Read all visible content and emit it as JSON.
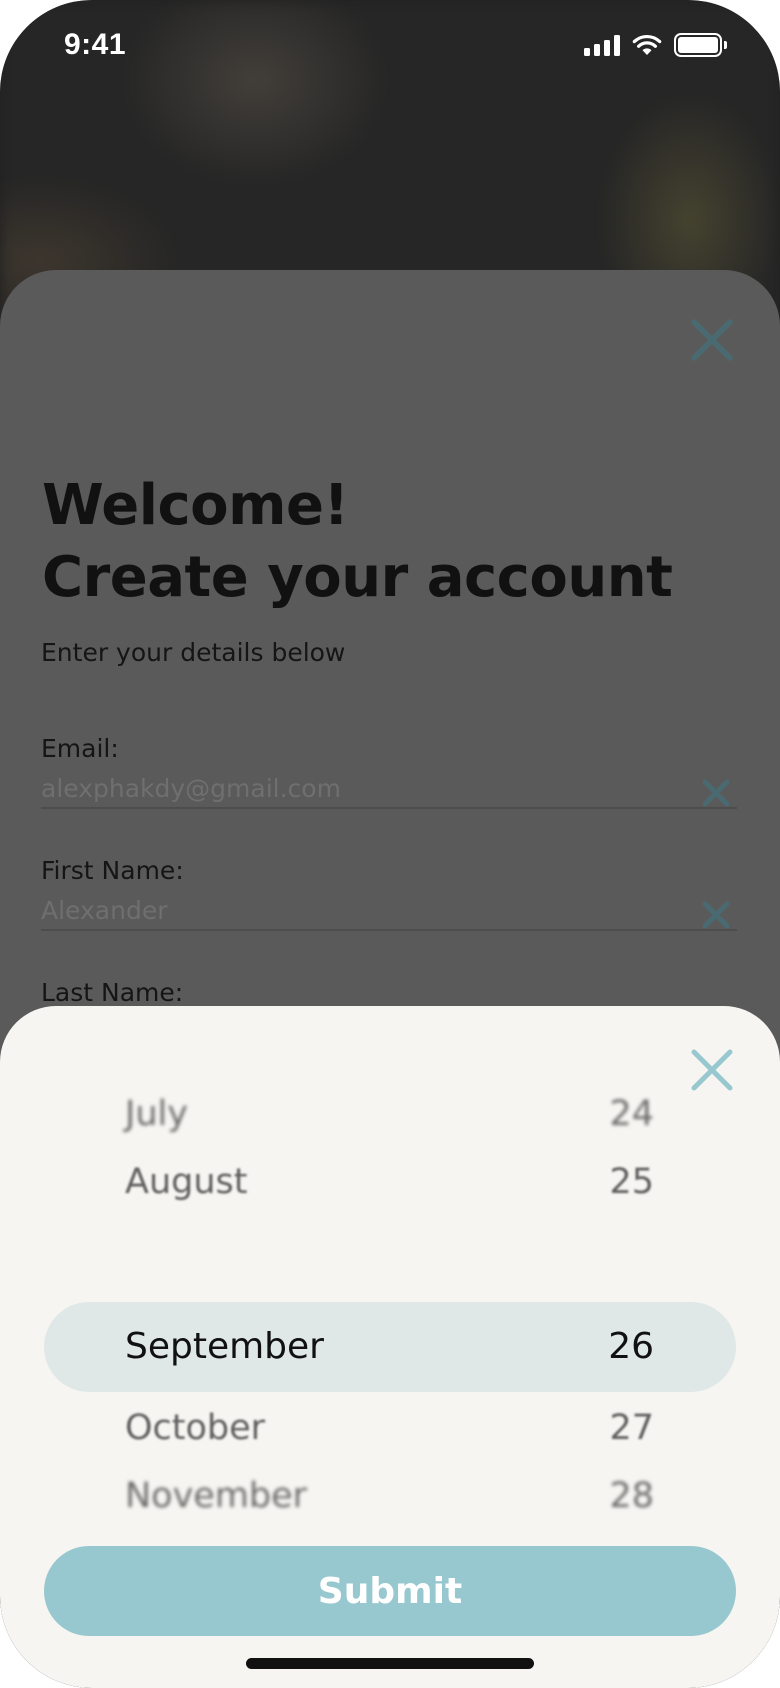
{
  "status_bar": {
    "time": "9:41",
    "icons": [
      "signal-icon",
      "wifi-icon",
      "battery-icon"
    ]
  },
  "form": {
    "title_line1": "Welcome!",
    "title_line2": "Create your account",
    "subtitle": "Enter your details below",
    "email": {
      "label": "Email:",
      "value": "alexphakdy@gmail.com"
    },
    "first_name": {
      "label": "First Name:",
      "value": "Alexander"
    },
    "last_name": {
      "label": "Last Name:"
    },
    "close_icon": "close-icon",
    "accent_color": "#4a6a72"
  },
  "picker": {
    "rows": [
      {
        "month": "July",
        "day": "24"
      },
      {
        "month": "August",
        "day": "25"
      },
      {
        "month": "September",
        "day": "26"
      },
      {
        "month": "October",
        "day": "27"
      },
      {
        "month": "November",
        "day": "28"
      }
    ],
    "selected_index": 2,
    "highlight_color": "#e0e8e7",
    "close_color": "#97c8cf",
    "submit_label": "Submit",
    "submit_color": "#97c8cf"
  }
}
